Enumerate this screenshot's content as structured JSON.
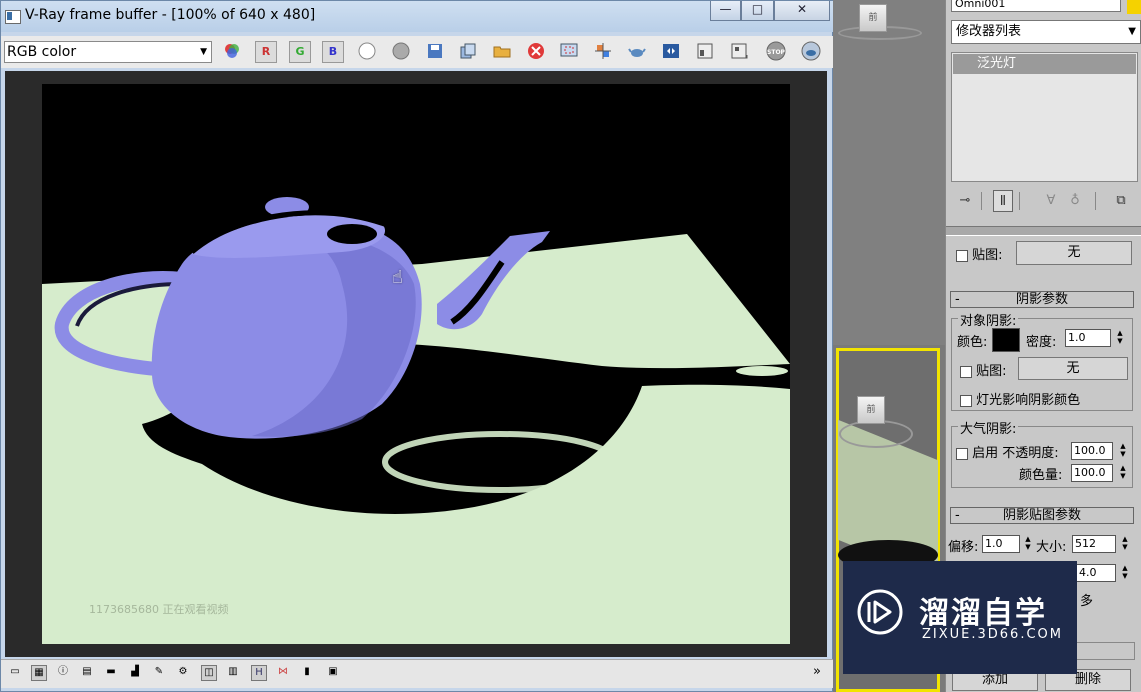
{
  "vfb": {
    "title": "V-Ray frame buffer - [100% of 640 x 480]",
    "window_buttons": {
      "minimize": "—",
      "maximize": "□",
      "close": "✕"
    },
    "channel_select": {
      "value": "RGB color"
    },
    "toolbar_buttons": [
      {
        "name": "color-channels-icon",
        "label": ""
      },
      {
        "name": "red-channel-button",
        "label": "R"
      },
      {
        "name": "green-channel-button",
        "label": "G"
      },
      {
        "name": "blue-channel-button",
        "label": "B"
      },
      {
        "name": "white-circle-icon",
        "label": ""
      },
      {
        "name": "gray-circle-icon",
        "label": ""
      },
      {
        "name": "save-icon",
        "label": ""
      },
      {
        "name": "copy-icon",
        "label": ""
      },
      {
        "name": "open-folder-icon",
        "label": ""
      },
      {
        "name": "clear-icon",
        "label": ""
      },
      {
        "name": "region-render-icon",
        "label": ""
      },
      {
        "name": "track-mouse-icon",
        "label": ""
      },
      {
        "name": "teapot-render-icon",
        "label": ""
      },
      {
        "name": "compare-icon",
        "label": ""
      },
      {
        "name": "show-corrections-icon",
        "label": ""
      },
      {
        "name": "history-icon",
        "label": ""
      },
      {
        "name": "stop-icon",
        "label": "STOP"
      },
      {
        "name": "render-icon",
        "label": ""
      }
    ],
    "render_watermark": "1173685680 正在观看视频",
    "status_expand": "»"
  },
  "panel": {
    "object_name": "Omni001",
    "modifier_list": "修改器列表",
    "stack_item": "泛光灯",
    "map": {
      "label": "贴图:",
      "button": "无"
    },
    "shadow_rollout": "阴影参数",
    "object_shadows": {
      "title": "对象阴影:",
      "color_label": "颜色:",
      "color": "#000000",
      "density_label": "密度:",
      "density": "1.0",
      "map_label": "贴图:",
      "map_button": "无",
      "light_affects": "灯光影响阴影颜色"
    },
    "atmosphere": {
      "title": "大气阴影:",
      "on_label": "启用",
      "opacity_label": "不透明度:",
      "opacity": "100.0",
      "color_amount_label": "颜色量:",
      "color_amount": "100.0"
    },
    "shadow_map_rollout": "阴影贴图参数",
    "shadow_map": {
      "bias_label": "偏移:",
      "bias": "1.0",
      "size_label": "大小:",
      "size": "512",
      "sample_range": "4.0",
      "partial_text": "多"
    },
    "add_button": "添加",
    "delete_button": "删除"
  },
  "watermark": {
    "brand_cn": "溜溜自学",
    "brand_en": "ZIXUE.3D66.COM"
  },
  "colors": {
    "teapot": "#8c8ce6",
    "floor": "#d6eccc",
    "vp_highlight": "#f2e400",
    "watermark_bg": "#1e2a4a"
  }
}
